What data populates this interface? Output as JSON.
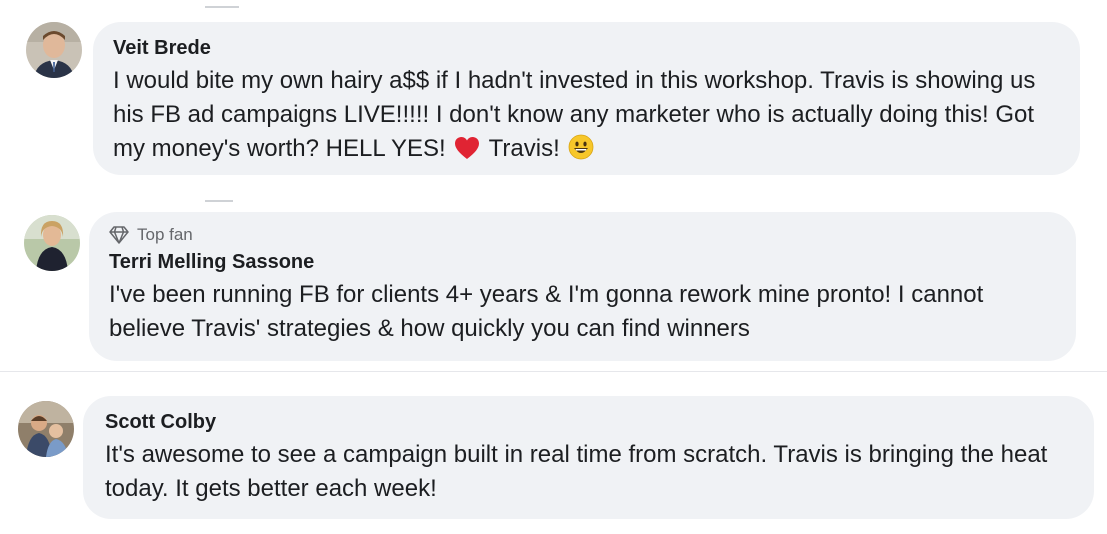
{
  "comments": [
    {
      "author": "Veit Brede",
      "avatar_icon": "avatar-man-suit",
      "text_before_heart": "I would bite my own hairy a$$ if I hadn't invested in this workshop. Travis is showing us his FB ad campaigns LIVE!!!!! I don't know any marketer who is actually doing this! Got my money's worth? HELL YES!",
      "text_after_heart": "Travis!",
      "emoji_1": "red-heart-icon",
      "emoji_2": "grinning-face-icon"
    },
    {
      "badge": "Top fan",
      "badge_icon": "diamond-icon",
      "author": "Terri Melling Sassone",
      "avatar_icon": "avatar-woman",
      "text": "I've been running FB for clients 4+ years & I'm gonna rework mine pronto! I cannot believe Travis' strategies & how quickly you can find winners"
    },
    {
      "author": "Scott Colby",
      "avatar_icon": "avatar-group-photo",
      "text": "It's awesome to see a campaign built in real time from scratch. Travis is bringing the heat today. It gets better each week!"
    }
  ],
  "colors": {
    "bubble_bg": "#f0f2f5",
    "text": "#1c1e21",
    "secondary_text": "#65676b",
    "heart": "#e02433",
    "emoji_yellow": "#f7c72a"
  }
}
